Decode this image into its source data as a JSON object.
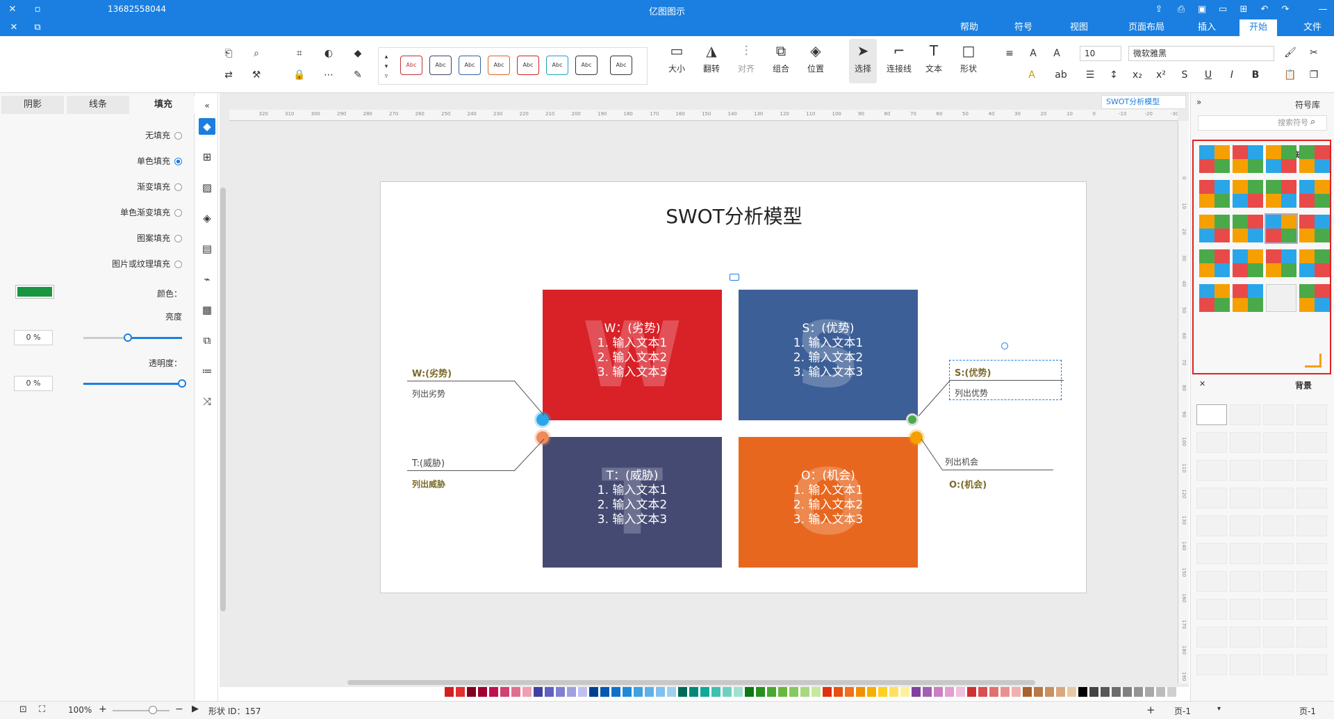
{
  "window": {
    "title": "亿图图示",
    "phone": "13682558044"
  },
  "menu": {
    "tabs": [
      "文件",
      "开始",
      "插入",
      "页面布局",
      "视图",
      "符号",
      "帮助"
    ],
    "active": "开始"
  },
  "ribbon": {
    "font_name": "微软雅黑",
    "font_size": "10",
    "tools": [
      "形状",
      "文本",
      "连接线",
      "选择",
      "位置",
      "组合",
      "对齐",
      "翻转",
      "大小"
    ],
    "style_sample": "Abc"
  },
  "left_panel": {
    "tabs": [
      "填充",
      "线条",
      "阴影"
    ],
    "fill_options": [
      "无填充",
      "单色填充",
      "渐变填充",
      "单色渐变填充",
      "图案填充",
      "图片或纹理填充"
    ],
    "selected_option": "单色填充",
    "labels": {
      "color": "颜色：",
      "shade": "亮度",
      "transparency": "透明度："
    },
    "color_value": "#1a9640",
    "shade_value": "0 %",
    "transparency_value": "0 %",
    "shade_level": 0.55,
    "transparency_level": 0.0
  },
  "canvas": {
    "doc_tab": "SWOT分析模型",
    "diagram_title": "SWOT分析模型",
    "quadrants": [
      {
        "letter": "S",
        "lines": [
          "S：(优势)",
          "1. 输入文本1",
          "2. 输入文本2",
          "3. 输入文本3"
        ],
        "color": "#3d5f97"
      },
      {
        "letter": "W",
        "lines": [
          "W：(劣势)",
          "1. 输入文本1",
          "2. 输入文本2",
          "3. 输入文本3"
        ],
        "color": "#d92128"
      },
      {
        "letter": "O",
        "lines": [
          "O：(机会)",
          "1. 输入文本1",
          "2. 输入文本2",
          "3. 输入文本3"
        ],
        "color": "#e8671e"
      },
      {
        "letter": "T",
        "lines": [
          "T：(威胁)",
          "1. 输入文本1",
          "2. 输入文本2",
          "3. 输入文本3"
        ],
        "color": "#454a72"
      }
    ],
    "labels": {
      "s_head": "S:(优势)",
      "s_sub": "列出优势",
      "w_head": "W:(劣势)",
      "w_sub": "列出劣势",
      "o_head": "O:(机会)",
      "o_sub": "列出机会",
      "t_head": "T:(威胁)",
      "t_sub": "列出威胁"
    },
    "ruler_h": [
      "-30",
      "-20",
      "-10",
      "0",
      "10",
      "20",
      "30",
      "40",
      "50",
      "60",
      "70",
      "80",
      "90",
      "100",
      "110",
      "120",
      "130",
      "140",
      "150",
      "160",
      "170",
      "180",
      "190",
      "200",
      "210",
      "220",
      "230",
      "240",
      "250",
      "260",
      "270",
      "280",
      "290",
      "300",
      "310",
      "320"
    ],
    "ruler_v": [
      "0",
      "10",
      "20",
      "30",
      "40",
      "50",
      "60",
      "70",
      "80",
      "90",
      "100",
      "110",
      "120",
      "130",
      "140",
      "150",
      "160",
      "170",
      "180",
      "190"
    ]
  },
  "right_panel": {
    "title": "符号库",
    "search_placeholder": "搜索符号",
    "library_name": "矩阵",
    "background_section": "背景"
  },
  "status": {
    "page_tab": "页-1",
    "page_select": "页-1",
    "shape_id": "形状 ID：157",
    "zoom": "100%"
  },
  "colors": {
    "accent": "#1a7fe0"
  }
}
